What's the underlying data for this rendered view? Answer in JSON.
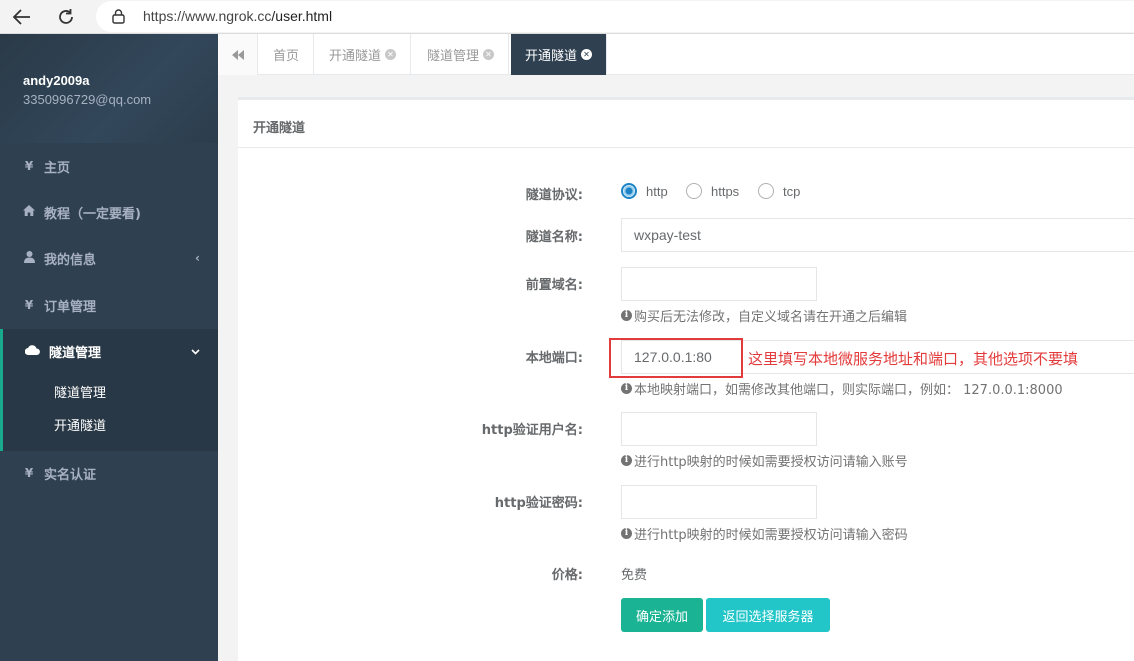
{
  "browser": {
    "url_scheme": "https://www.ngrok.cc",
    "url_path": "/user.html"
  },
  "sidebar": {
    "username": "andy2009a",
    "email": "3350996729@qq.com",
    "items": [
      {
        "icon": "yen-icon",
        "label": "主页"
      },
      {
        "icon": "home-icon",
        "label": "教程（一定要看)"
      },
      {
        "icon": "user-icon",
        "label": "我的信息"
      },
      {
        "icon": "yen-icon",
        "label": "订单管理"
      },
      {
        "icon": "cloud-icon",
        "label": "隧道管理"
      },
      {
        "icon": "yen-icon",
        "label": "实名认证"
      }
    ],
    "subitems": [
      "隧道管理",
      "开通隧道"
    ]
  },
  "tabs": [
    "首页",
    "开通隧道",
    "隧道管理",
    "开通隧道"
  ],
  "panel": {
    "title": "开通隧道"
  },
  "form": {
    "protocol_label": "隧道协议:",
    "protocol_options": [
      "http",
      "https",
      "tcp"
    ],
    "protocol_selected": "http",
    "name_label": "隧道名称:",
    "name_value": "wxpay-test",
    "domain_label": "前置域名:",
    "domain_value": "",
    "domain_help": "购买后无法修改，自定义域名请在开通之后编辑",
    "port_label": "本地端口:",
    "port_value": "127.0.0.1:80",
    "port_note": "这里填写本地微服务地址和端口，其他选项不要填",
    "port_help": "本地映射端口，如需修改其他端口，则实际端口，例如： 127.0.0.1:8000",
    "user_label": "http验证用户名:",
    "user_help": "进行http映射的时候如需要授权访问请输入账号",
    "pass_label": "http验证密码:",
    "pass_help": "进行http映射的时候如需要授权访问请输入密码",
    "price_label": "价格:",
    "price_value": "免费",
    "submit_label": "确定添加",
    "back_label": "返回选择服务器"
  },
  "colors": {
    "sidebar_bg": "#2f4050",
    "accent_green": "#1ab394",
    "accent_cyan": "#23c6c8",
    "highlight_red": "#e33b3b"
  }
}
